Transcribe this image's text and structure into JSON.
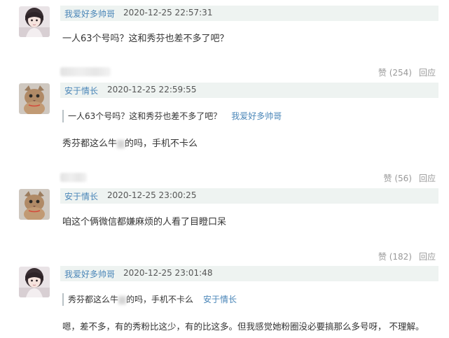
{
  "comments": [
    {
      "username": "我爱好多帅哥",
      "time": "2020-12-25 22:57:31",
      "text": "一人63个号吗？这和秀芬也差不多了吧？"
    },
    {
      "username": "安于情长",
      "time": "2020-12-25 22:59:55",
      "quote_text": "一人63个号吗？这和秀芬也差不多了吧？",
      "quote_user": "我爱好多帅哥",
      "text_before": "秀芬都这么牛",
      "text_after": "的吗，手机不卡么",
      "like_label": "赞 (254)",
      "reply_label": "回应"
    },
    {
      "username": "安于情长",
      "time": "2020-12-25 23:00:25",
      "text": "咱这个俩微信都嫌麻烦的人看了目瞪口呆",
      "like_label": "赞 (56)",
      "reply_label": "回应"
    },
    {
      "username": "我爱好多帅哥",
      "time": "2020-12-25 23:01:48",
      "quote_before": "秀芬都这么牛",
      "quote_after": "的吗，手机不卡么",
      "quote_user": "安于情长",
      "text": "嗯，差不多，有的秀粉比这少，有的比这多。但我感觉她粉圈没必要搞那么多号呀， 不理解。",
      "like_label": "赞 (182)",
      "reply_label": "回应"
    }
  ],
  "colors": {
    "username": "#4a86b8",
    "meta_bar": "#eef3f1",
    "action_text": "#999999"
  }
}
